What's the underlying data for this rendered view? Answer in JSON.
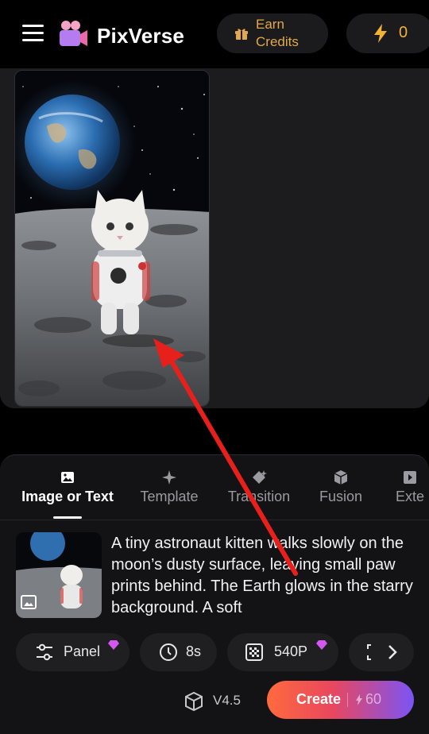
{
  "header": {
    "brand": "PixVerse",
    "earn_credits_label": "Earn\nCredits",
    "credits_value": "0"
  },
  "tabs": [
    {
      "label": "Image or Text",
      "icon": "image-icon",
      "active": true
    },
    {
      "label": "Template",
      "icon": "sparkle-icon",
      "active": false
    },
    {
      "label": "Transition",
      "icon": "transition-icon",
      "active": false
    },
    {
      "label": "Fusion",
      "icon": "cube-icon",
      "active": false
    },
    {
      "label": "Exte",
      "icon": "extend-icon",
      "active": false
    }
  ],
  "prompt": {
    "text": "A tiny astronaut kitten walks slowly on the moon’s dusty surface, leaving small paw prints behind. The Earth glows in the starry background. A soft"
  },
  "options": {
    "panel_label": "Panel",
    "duration_label": "8s",
    "resolution_label": "540P"
  },
  "footer": {
    "model_label": "V4.5",
    "create_label": "Create",
    "create_cost": "60"
  },
  "colors": {
    "accent_gold": "#f2b233",
    "earn_text": "#e3a84d",
    "annotation_arrow": "#e8201c",
    "create_gradient": [
      "#ff6a3d",
      "#e8475f",
      "#7b54f5"
    ]
  }
}
